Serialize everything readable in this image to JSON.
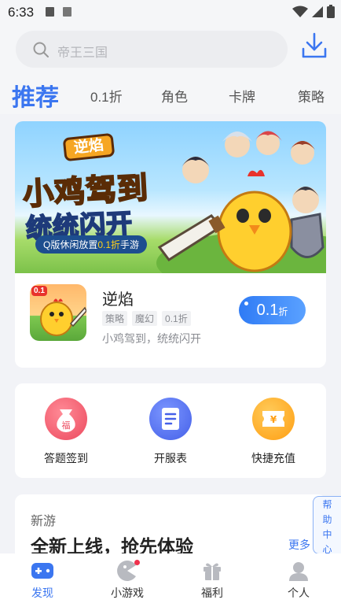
{
  "status_bar": {
    "time": "6:33"
  },
  "search": {
    "placeholder": "帝王三国"
  },
  "tabs": [
    {
      "label": "推荐",
      "active": true
    },
    {
      "label": "0.1折",
      "active": false
    },
    {
      "label": "角色",
      "active": false
    },
    {
      "label": "卡牌",
      "active": false
    },
    {
      "label": "策略",
      "active": false
    }
  ],
  "banner": {
    "logo_text": "逆焰",
    "title_line1": "小鸡驾到",
    "title_line2": "统统闪开",
    "subtitle_prefix": "Q版休闲放置",
    "subtitle_highlight": "0.1折",
    "subtitle_suffix": "手游"
  },
  "featured_game": {
    "icon_tag": "0.1",
    "name": "逆焰",
    "tags": [
      "策略",
      "魔幻",
      "0.1折"
    ],
    "description": "小鸡驾到，统统闪开",
    "discount_value": "0.1",
    "discount_unit": "折"
  },
  "quick_actions": [
    {
      "label": "答题签到",
      "icon": "lucky-bag-icon",
      "color": "#f0566a"
    },
    {
      "label": "开服表",
      "icon": "server-list-icon",
      "color": "#4a6ff0"
    },
    {
      "label": "快捷充值",
      "icon": "recharge-coupon-icon",
      "color": "#ffad1f"
    }
  ],
  "new_games": {
    "heading": "新游",
    "title": "全新上线，抢先体验",
    "more_label": "更多"
  },
  "help": [
    "帮",
    "助",
    "中",
    "心"
  ],
  "bottom_nav": [
    {
      "label": "发现",
      "icon": "gamepad-icon",
      "active": true
    },
    {
      "label": "小游戏",
      "icon": "mini-game-icon",
      "active": false,
      "badge": true
    },
    {
      "label": "福利",
      "icon": "gift-icon",
      "active": false
    },
    {
      "label": "个人",
      "icon": "user-icon",
      "active": false
    }
  ],
  "colors": {
    "accent": "#3b76f0",
    "background": "#f2f3f7"
  }
}
